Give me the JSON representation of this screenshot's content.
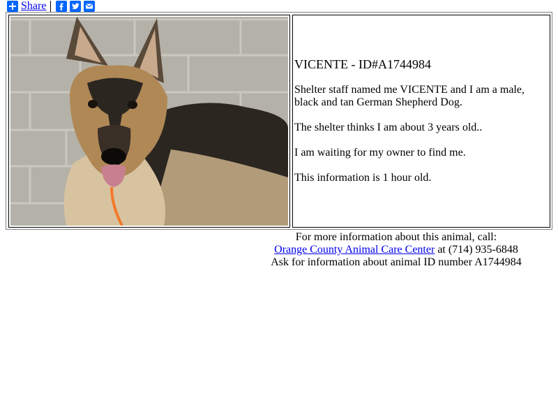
{
  "share": {
    "label": "Share"
  },
  "social": {
    "icons": [
      "facebook-icon",
      "twitter-icon",
      "email-icon"
    ]
  },
  "animal": {
    "title": "VICENTE - ID#A1744984",
    "p1": "Shelter staff named me VICENTE and I am a male, black and tan German Shepherd Dog.",
    "p2": "The shelter thinks I am about 3 years old..",
    "p3": "I am waiting for my owner to find me.",
    "p4": "This information is 1 hour old."
  },
  "contact": {
    "line1": "For more information about this animal, call:",
    "shelter_link": "Orange County Animal Care Center",
    "phone_text": " at (714) 935-6848",
    "line3": "Ask for information about animal ID number A1744984"
  },
  "colors": {
    "link": "#0000ee",
    "share_blue": "#0166ff"
  }
}
